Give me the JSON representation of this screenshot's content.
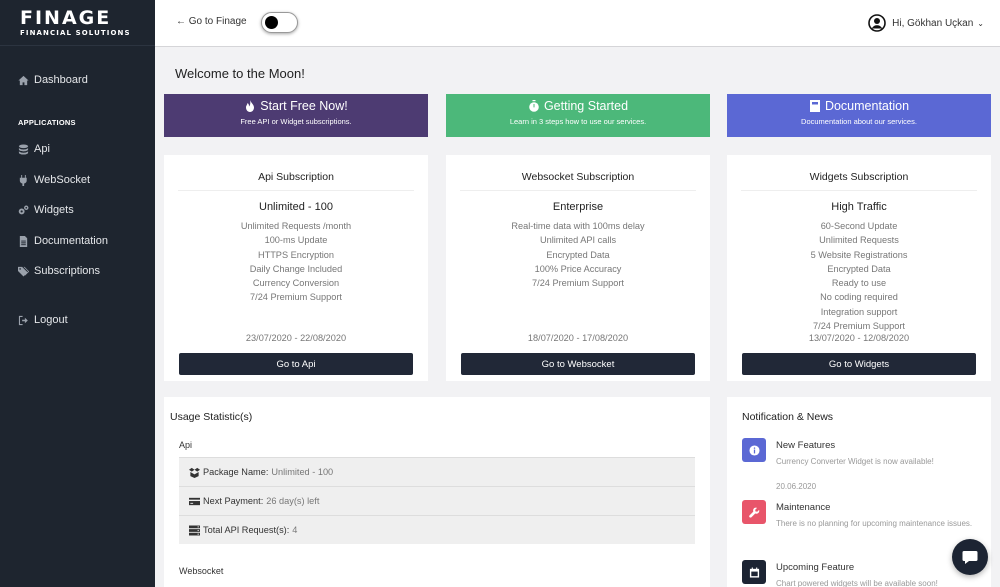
{
  "logo": {
    "main": "FINAGE",
    "sub": "FINANCIAL SOLUTIONS"
  },
  "sidebar": {
    "dashboard": "Dashboard",
    "section": "APPLICATIONS",
    "items": [
      {
        "label": "Api"
      },
      {
        "label": "WebSocket"
      },
      {
        "label": "Widgets"
      },
      {
        "label": "Documentation"
      },
      {
        "label": "Subscriptions"
      }
    ],
    "logout": "Logout"
  },
  "topbar": {
    "goto": "← Go to Finage",
    "user": "Hi, Gökhan Uçkan"
  },
  "welcome": "Welcome to the Moon!",
  "banners": [
    {
      "title": "Start Free Now!",
      "subtitle": "Free API or Widget subscriptions.",
      "color": "#4d3b72"
    },
    {
      "title": "Getting Started",
      "subtitle": "Learn in 3 steps how to use our services.",
      "color": "#4cb87a"
    },
    {
      "title": "Documentation",
      "subtitle": "Documentation about our services.",
      "color": "#5b68d4"
    }
  ],
  "cards": [
    {
      "title": "Api Subscription",
      "plan": "Unlimited - 100",
      "features": [
        "Unlimited Requests /month",
        "100-ms Update",
        "HTTPS Encryption",
        "Daily Change Included",
        "Currency Conversion",
        "7/24 Premium Support"
      ],
      "dates": "23/07/2020 - 22/08/2020",
      "button": "Go to Api"
    },
    {
      "title": "Websocket Subscription",
      "plan": "Enterprise",
      "features": [
        "Real-time data with 100ms delay",
        "Unlimited API calls",
        "Encrypted Data",
        "100% Price Accuracy",
        "7/24 Premium Support"
      ],
      "dates": "18/07/2020 - 17/08/2020",
      "button": "Go to Websocket"
    },
    {
      "title": "Widgets Subscription",
      "plan": "High Traffic",
      "features": [
        "60-Second Update",
        "Unlimited Requests",
        "5 Website Registrations",
        "Encrypted Data",
        "Ready to use",
        "No coding required",
        "Integration support",
        "7/24 Premium Support"
      ],
      "dates": "13/07/2020 - 12/08/2020",
      "button": "Go to Widgets"
    }
  ],
  "usage": {
    "title": "Usage Statistic(s)",
    "api_label": "Api",
    "rows": [
      {
        "label": "Package Name:",
        "value": "Unlimited - 100"
      },
      {
        "label": "Next Payment:",
        "value": "26 day(s) left"
      },
      {
        "label": "Total API Request(s):",
        "value": "4"
      }
    ],
    "websocket_label": "Websocket"
  },
  "notifications": {
    "title": "Notification & News",
    "items": [
      {
        "title": "New Features",
        "desc": "Currency Converter Widget is now available!",
        "date": "20.06.2020",
        "color": "#5b68d4"
      },
      {
        "title": "Maintenance",
        "desc": "There is no planning for upcoming maintenance issues.",
        "color": "#e8556a"
      },
      {
        "title": "Upcoming Feature",
        "desc": "Chart powered widgets will be available soon!",
        "color": "#1c2433"
      }
    ]
  }
}
